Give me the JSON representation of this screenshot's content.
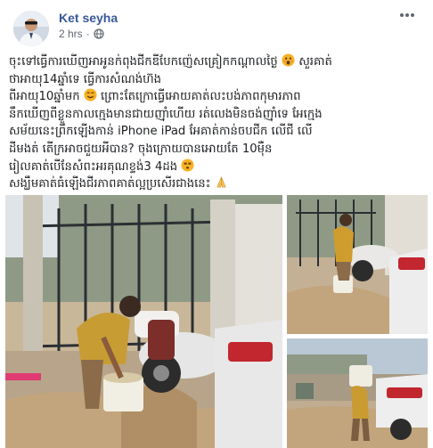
{
  "post": {
    "author": "Ket seyha",
    "time": "2 hrs",
    "time_separator": "·",
    "privacy_icon": "globe-icon",
    "more_icon": "more-options-icon",
    "text_lines": [
      "ចុះទៅធ្វើការឃើញអាអូនក់ពុងជីកឌីបែកញ៉េសគ្រៀកកណ្ដាលថ្ងៃ",
      "ថាអាយុ14ឆ្នាំទេ ធ្វើការសំណង់ហ៊ង",
      "ពីអាយុ10ឆ្នាំមក",
      "នឹកឃើញពីខ្លួនកាលក្មេងមានជាយញ៉ាំហើយ រត់លេងមិនចង់ញ៉ាំទេ អែក្មេង",
      "សម័យនេះព្រឹកឡើងកាន់ iPhone iPad អែគាត់កាន់ចបជីក លើជី លើ",
      "ដីមងត់ តើក្រអាចជួយអីបាន? ចុងក្រោយបានអោយតែ 10ម៉ឺន",
      "រៀលគាត់បើនែសំពះអរគុណខ្ទង់3 4ដង",
      "សង្ឃឹមគាត់ធំឡើងជីរភាពគាត់ល្អប្រសើរជាងនេះ"
    ],
    "emoji_icons": [
      "shocked-face-emoji",
      "smiling-face-emoji",
      "dizzy-face-emoji",
      "folded-hands-emoji"
    ],
    "photos": [
      {
        "name": "photo-main",
        "description_icon": "child-carrying-sand-photo"
      },
      {
        "name": "photo-top-right",
        "description_icon": "child-shoveling-photo"
      },
      {
        "name": "photo-bottom-right",
        "description_icon": "child-carrying-bucket-photo"
      }
    ]
  }
}
